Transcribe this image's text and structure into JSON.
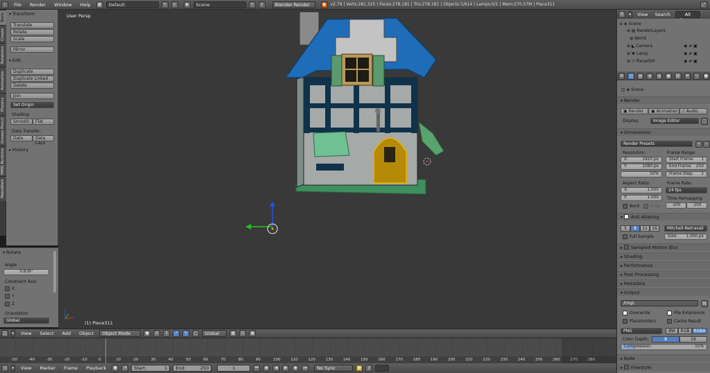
{
  "top_bar": {
    "menus": [
      "File",
      "Render",
      "Window",
      "Help"
    ],
    "layout": "Default",
    "scene": "Scene",
    "engine": "Blender Render",
    "stats": "v2.79 | Verts:281,325 | Faces:278,181 | Tris:278,181 | Objects:1/614 | Lamps:0/1 | Mem:270.57M | Piece311"
  },
  "tool_tabs": [
    "Tools",
    "Create",
    "Relations",
    "Animation",
    "Physics",
    "Grease Pencil",
    "MMD Runtime",
    "MakeWalk"
  ],
  "tool_shelf": {
    "transform_header": "Transform",
    "transform_buttons": [
      "Translate",
      "Rotate",
      "Scale"
    ],
    "mirror": "Mirror",
    "edit_header": "Edit",
    "edit_buttons": [
      "Duplicate",
      "Duplicate Linked",
      "Delete"
    ],
    "join": "Join",
    "set_origin": "Set Origin",
    "shading_label": "Shading:",
    "smooth": "Smooth",
    "flat": "Flat",
    "data_transfer_label": "Data Transfer:",
    "data": "Data",
    "data_layo": "Data Layo",
    "history_header": "History"
  },
  "operator_panel": {
    "header": "Rotate",
    "angle_label": "Angle",
    "angle_value": "0.839°",
    "constraint_label": "Constraint Axis",
    "axes": [
      "X",
      "Y",
      "Z"
    ],
    "orientation_label": "Orientation",
    "orientation_value": "Global"
  },
  "viewport": {
    "view_label": "User Persp",
    "object_label": "(1) Piece311"
  },
  "viewport_header": {
    "menus": [
      "View",
      "Select",
      "Add",
      "Object"
    ],
    "mode": "Object Mode",
    "orientation": "Global"
  },
  "timeline": {
    "ticks": [
      "-50",
      "-40",
      "-30",
      "-20",
      "-10",
      "0",
      "10",
      "20",
      "30",
      "40",
      "50",
      "60",
      "70",
      "80",
      "90",
      "100",
      "110",
      "120",
      "130",
      "140",
      "150",
      "160",
      "170",
      "180",
      "190",
      "200",
      "210",
      "220",
      "230",
      "240",
      "250",
      "260",
      "270",
      "280"
    ],
    "menus": [
      "View",
      "Marker",
      "Frame",
      "Playback"
    ],
    "start_label": "Start:",
    "start_value": "1",
    "end_label": "End:",
    "end_value": "250",
    "current_frame": "1",
    "sync": "No Sync"
  },
  "outliner": {
    "menus": [
      "View",
      "Search"
    ],
    "filter": "All Scenes",
    "items": [
      "Scene",
      "RenderLayers",
      "World",
      "Camera",
      "Lamp",
      "Piece000"
    ]
  },
  "properties": {
    "context": "Scene",
    "render_header": "Render",
    "render_btn": "Render",
    "animation_btn": "Animation",
    "audio_btn": "Audio",
    "display_label": "Display:",
    "display_value": "Image Editor",
    "dimensions_header": "Dimensions",
    "render_presets": "Render Presets",
    "resolution_label": "Resolution:",
    "res_x_label": "X:",
    "res_x": "1920 px",
    "res_y_label": "Y:",
    "res_y": "1080 px",
    "res_pct": "50%",
    "frame_range_label": "Frame Range:",
    "start_frame_label": "Start Frame:",
    "start_frame": "1",
    "end_frame_label": "End Frame:",
    "end_frame": "250",
    "frame_step_label": "Frame Step:",
    "frame_step": "1",
    "aspect_label": "Aspect Ratio:",
    "aspect_x_label": "X:",
    "aspect_x": "1.000",
    "aspect_y_label": "Y:",
    "aspect_y": "1.000",
    "frame_rate_label": "Frame Rate:",
    "fps": "24 fps",
    "time_remap_label": "Time Remapping:",
    "remap_old": "·100",
    "remap_new": "·100",
    "border": "Bord",
    "crop": "Crop",
    "aa_header": "Anti-Aliasing",
    "aa_samples": [
      "5",
      "8",
      "11",
      "16"
    ],
    "aa_filter": "Mitchell-Netravali",
    "full_sample": "Full Sample",
    "size_label": "Size:",
    "size_value": "1.000 px",
    "collapsed_panels": [
      "Sampled Motion Blur",
      "Shading",
      "Performance",
      "Post Processing",
      "Metadata"
    ],
    "output_header": "Output",
    "output_path": "/tmp\\",
    "overwrite": "Overwrite",
    "file_ext": "File Extensions",
    "placeholders": "Placeholders",
    "cache_result": "Cache Result",
    "format": "PNG",
    "bw": "BW",
    "rgb": "RGB",
    "rgba": "RGBA",
    "color_depth_label": "Color Depth:",
    "depth_8": "8",
    "depth_16": "16",
    "compression_label": "Compression:",
    "compression": "15%",
    "bake_header": "Bake",
    "freestyle_header": "Freestyle"
  },
  "colors": {
    "viewport_bg": "#393939",
    "roof_blue": "#1f6db8",
    "door_gold": "#b58a06",
    "select_blue": "#5680c2",
    "frame_green": "#5cc13a"
  }
}
